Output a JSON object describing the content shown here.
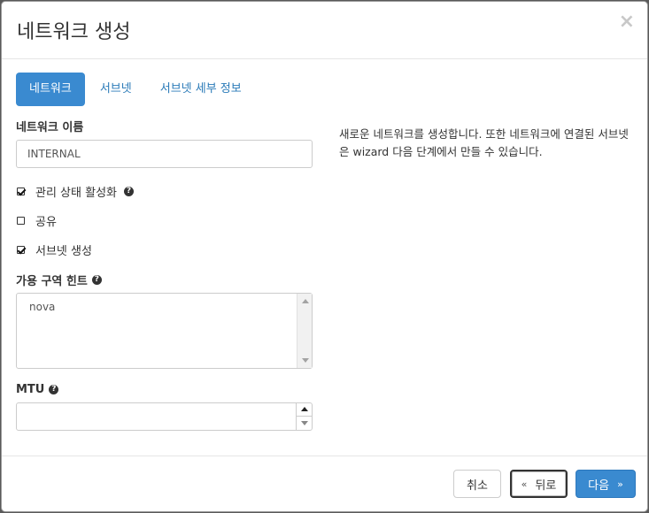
{
  "modal": {
    "title": "네트워크 생성",
    "close_icon": "×"
  },
  "tabs": [
    {
      "label": "네트워크",
      "active": true
    },
    {
      "label": "서브넷",
      "active": false
    },
    {
      "label": "서브넷 세부 정보",
      "active": false
    }
  ],
  "form": {
    "network_name": {
      "label": "네트워크 이름",
      "value": "INTERNAL"
    },
    "admin_state": {
      "label": "관리 상태 활성화",
      "checked": true
    },
    "shared": {
      "label": "공유",
      "checked": false
    },
    "create_subnet": {
      "label": "서브넷 생성",
      "checked": true
    },
    "az_hints": {
      "label": "가용 구역 힌트",
      "options": [
        "nova"
      ]
    },
    "mtu": {
      "label": "MTU",
      "value": ""
    }
  },
  "description": "새로운 네트워크를 생성합니다. 또한 네트워크에 연결된 서브넷은 wizard 다음 단계에서 만들 수 있습니다.",
  "footer": {
    "cancel_label": "취소",
    "back_label": "뒤로",
    "next_label": "다음",
    "back_chevron": "«",
    "next_chevron": "»"
  },
  "colors": {
    "accent": "#3a8ad0",
    "link": "#2a7ab8"
  }
}
